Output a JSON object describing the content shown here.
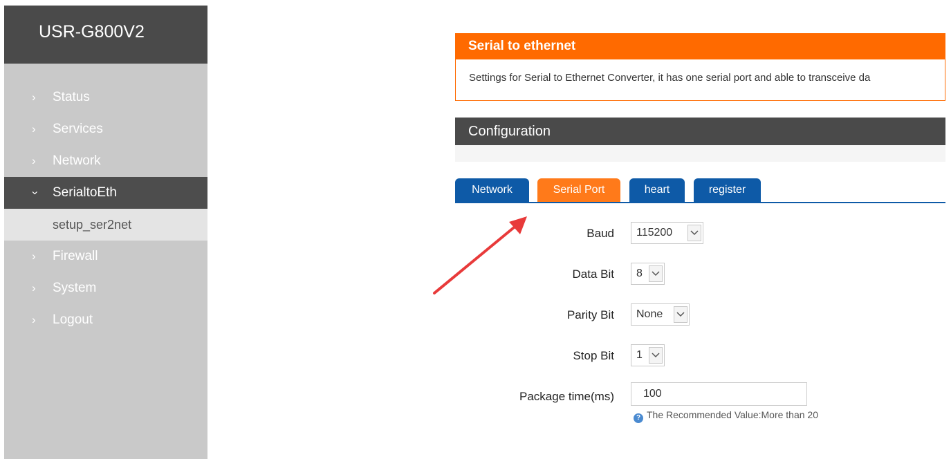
{
  "sidebar": {
    "brand": "USR-G800V2",
    "items": [
      {
        "label": "Status"
      },
      {
        "label": "Services"
      },
      {
        "label": "Network"
      },
      {
        "label": "SerialtoEth"
      },
      {
        "label": "setup_ser2net"
      },
      {
        "label": "Firewall"
      },
      {
        "label": "System"
      },
      {
        "label": "Logout"
      }
    ]
  },
  "banner": {
    "title": "Serial to ethernet",
    "description": "Settings for Serial to Ethernet Converter, it has one serial port and able to transceive da"
  },
  "config": {
    "title": "Configuration"
  },
  "tabs": [
    {
      "label": "Network"
    },
    {
      "label": "Serial Port"
    },
    {
      "label": "heart"
    },
    {
      "label": "register"
    }
  ],
  "form": {
    "baud": {
      "label": "Baud",
      "value": "115200"
    },
    "data_bit": {
      "label": "Data Bit",
      "value": "8"
    },
    "parity_bit": {
      "label": "Parity Bit",
      "value": "None"
    },
    "stop_bit": {
      "label": "Stop Bit",
      "value": "1"
    },
    "package_time": {
      "label": "Package time(ms)",
      "value": "100",
      "hint": "The Recommended Value:More than 20"
    }
  },
  "colors": {
    "accent_orange": "#ff6a00",
    "tab_blue": "#0e5aa7",
    "dark_header": "#4a4a4a",
    "arrow_red": "#e83a3a"
  }
}
